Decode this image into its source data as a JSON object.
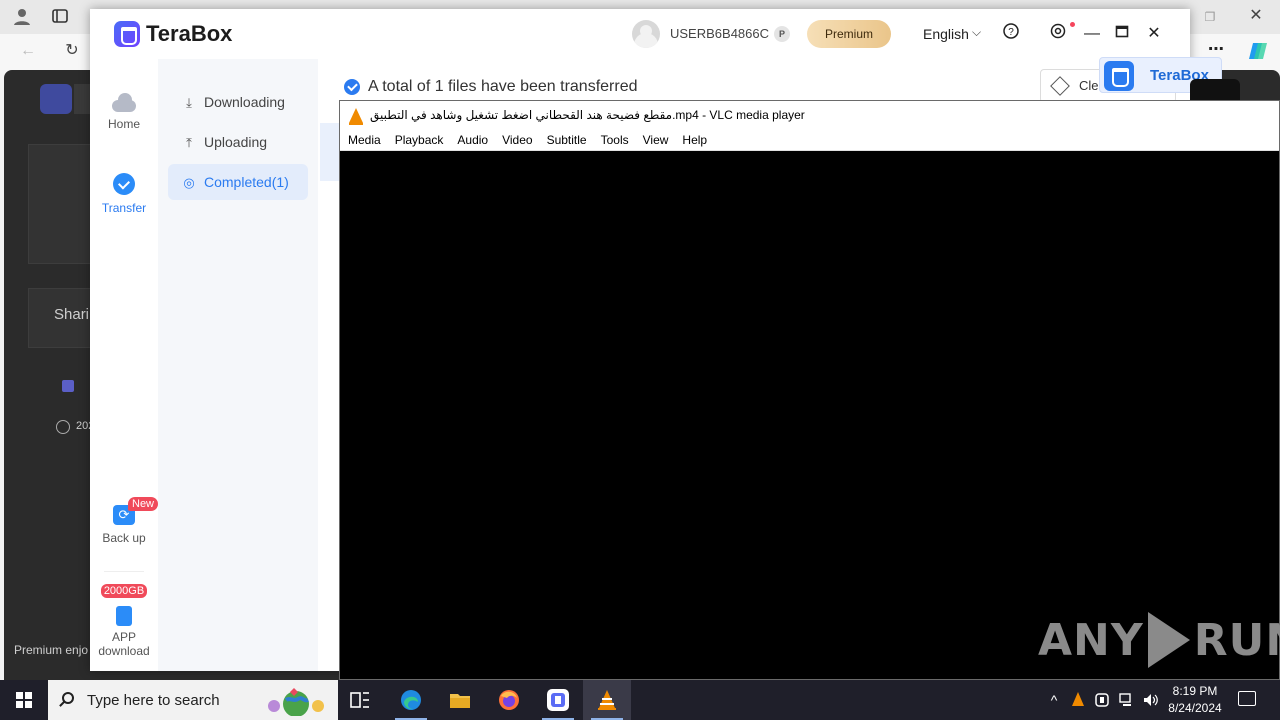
{
  "terabox": {
    "app_name": "TeraBox",
    "username": "USERB6B4866C",
    "user_badge": "P",
    "premium_label": "Premium",
    "language": "English",
    "rail": {
      "home": "Home",
      "transfer": "Transfer",
      "backup": "Back up",
      "new_badge": "New",
      "storage_badge": "2000GB",
      "app_download_line1": "APP",
      "app_download_line2": "download"
    },
    "side": {
      "downloading": "Downloading",
      "uploading": "Uploading",
      "completed": "Completed(1)"
    },
    "status_message": "A total of 1 files have been transferred",
    "clear_label": "Clea",
    "float_badge": "TeraBox"
  },
  "browser_bg": {
    "shari_text": "Shari",
    "year_text": "202",
    "premium_text": "Premium enjo"
  },
  "vlc": {
    "title": "مقطع فضيحة هند القحطاني اضغط تشغيل وشاهد في التطبيق.mp4 - VLC media player",
    "menu": [
      "Media",
      "Playback",
      "Audio",
      "Video",
      "Subtitle",
      "Tools",
      "View",
      "Help"
    ]
  },
  "watermark": {
    "left": "ANY",
    "right": "RUN"
  },
  "taskbar": {
    "search_placeholder": "Type here to search",
    "time": "8:19 PM",
    "date": "8/24/2024"
  },
  "colors": {
    "accent": "#2b7bf0",
    "premium_gold": "#eac58a",
    "badge_red": "#f04a5a",
    "vlc_orange": "#f08a00"
  }
}
